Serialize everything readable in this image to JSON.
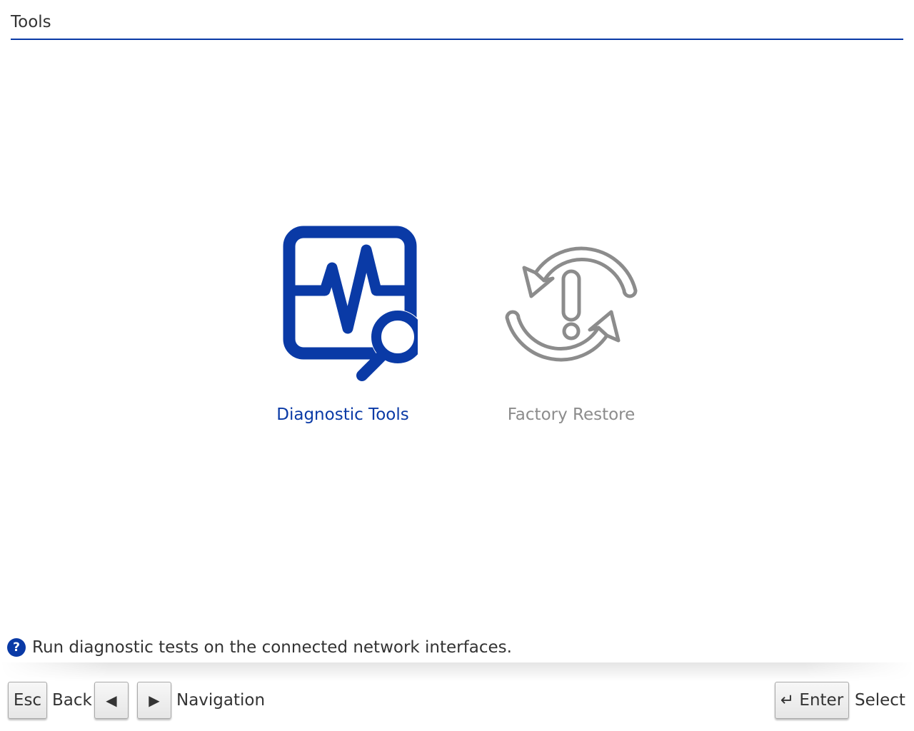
{
  "header": {
    "title": "Tools"
  },
  "tiles": [
    {
      "label": "Diagnostic Tools",
      "icon": "diagnostic-monitor-icon",
      "color": "#0a3aa6",
      "selected": true
    },
    {
      "label": "Factory Restore",
      "icon": "factory-restore-icon",
      "color": "#8c8c8c",
      "selected": false
    }
  ],
  "help": {
    "icon": "question-icon",
    "icon_glyph": "?",
    "text": "Run diagnostic tests on the connected network interfaces."
  },
  "footer": {
    "esc_key": "Esc",
    "back_label": "Back",
    "left_key": "◀",
    "right_key": "▶",
    "navigation_label": "Navigation",
    "enter_key": "↵ Enter",
    "select_label": "Select"
  },
  "colors": {
    "accent": "#0a3aa6",
    "disabled": "#8c8c8c",
    "text": "#333333"
  }
}
